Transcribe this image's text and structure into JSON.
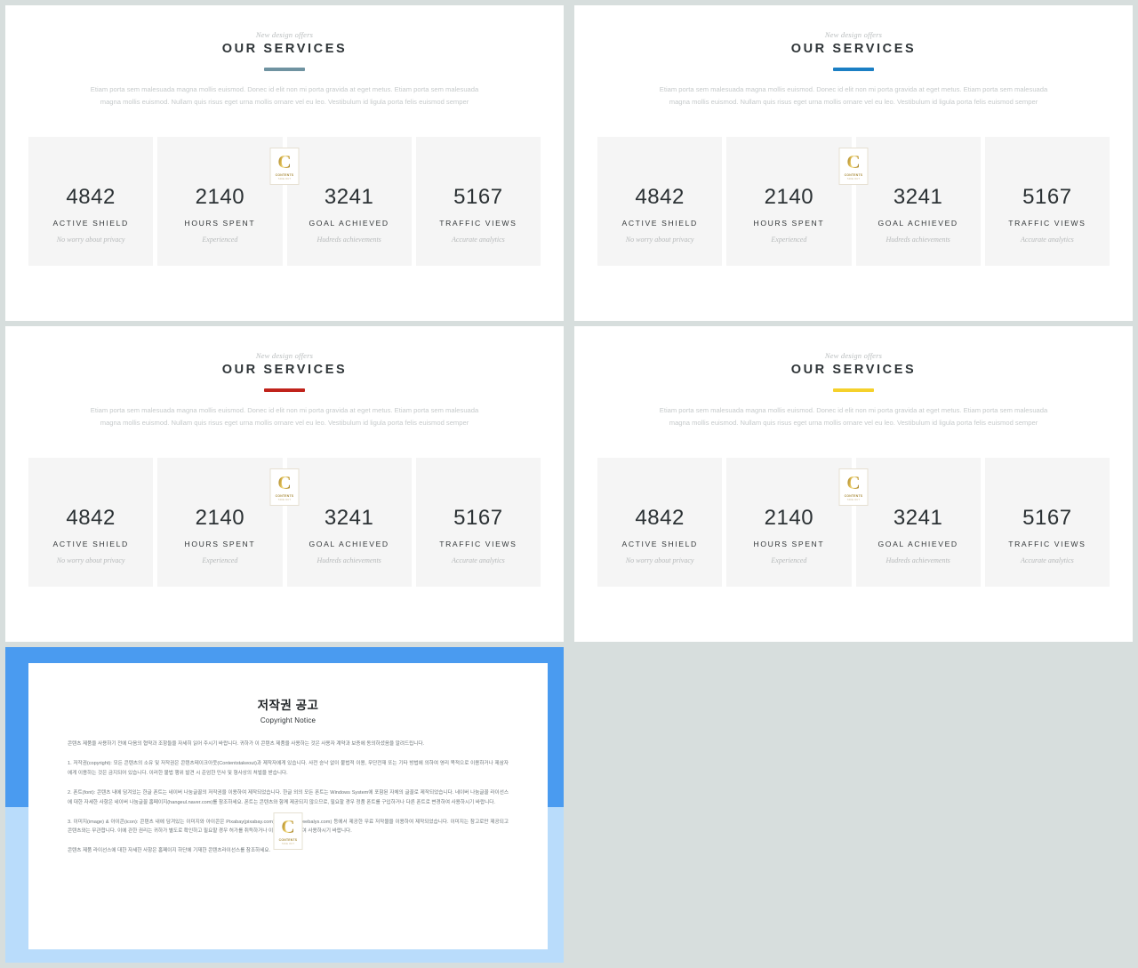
{
  "background_color": "#d7dedd",
  "slides": [
    {
      "id": "slide-1",
      "eyebrow": "New design offers",
      "title": "OUR SERVICES",
      "accent_color": "#6f93a1",
      "lead": "Etiam porta sem malesuada magna mollis euismod. Donec id elit non mi porta gravida at eget metus. Etiam porta sem malesuada magna mollis euismod. Nullam quis risus eget urna mollis ornare vel eu leo. Vestibulum id ligula porta felis euismod semper",
      "stats": [
        {
          "value": "4842",
          "label": "ACTIVE SHIELD",
          "sub": "No worry about privacy"
        },
        {
          "value": "2140",
          "label": "HOURS SPENT",
          "sub": "Experienced"
        },
        {
          "value": "3241",
          "label": "GOAL ACHIEVED",
          "sub": "Hudreds achievements"
        },
        {
          "value": "5167",
          "label": "TRAFFIC VIEWS",
          "sub": "Accurate analytics"
        }
      ]
    },
    {
      "id": "slide-2",
      "eyebrow": "New design offers",
      "title": "OUR SERVICES",
      "accent_color": "#1b7fc4",
      "lead": "Etiam porta sem malesuada magna mollis euismod. Donec id elit non mi porta gravida at eget metus. Etiam porta sem malesuada magna mollis euismod. Nullam quis risus eget urna mollis ornare vel eu leo. Vestibulum id ligula porta felis euismod semper",
      "stats": [
        {
          "value": "4842",
          "label": "ACTIVE SHIELD",
          "sub": "No worry about privacy"
        },
        {
          "value": "2140",
          "label": "HOURS SPENT",
          "sub": "Experienced"
        },
        {
          "value": "3241",
          "label": "GOAL ACHIEVED",
          "sub": "Hudreds achievements"
        },
        {
          "value": "5167",
          "label": "TRAFFIC VIEWS",
          "sub": "Accurate analytics"
        }
      ]
    },
    {
      "id": "slide-3",
      "eyebrow": "New design offers",
      "title": "OUR SERVICES",
      "accent_color": "#c0231b",
      "lead": "Etiam porta sem malesuada magna mollis euismod. Donec id elit non mi porta gravida at eget metus. Etiam porta sem malesuada magna mollis euismod. Nullam quis risus eget urna mollis ornare vel eu leo. Vestibulum id ligula porta felis euismod semper",
      "stats": [
        {
          "value": "4842",
          "label": "ACTIVE SHIELD",
          "sub": "No worry about privacy"
        },
        {
          "value": "2140",
          "label": "HOURS SPENT",
          "sub": "Experienced"
        },
        {
          "value": "3241",
          "label": "GOAL ACHIEVED",
          "sub": "Hudreds achievements"
        },
        {
          "value": "5167",
          "label": "TRAFFIC VIEWS",
          "sub": "Accurate analytics"
        }
      ]
    },
    {
      "id": "slide-4",
      "eyebrow": "New design offers",
      "title": "OUR SERVICES",
      "accent_color": "#f5d12b",
      "lead": "Etiam porta sem malesuada magna mollis euismod. Donec id elit non mi porta gravida at eget metus. Etiam porta sem malesuada magna mollis euismod. Nullam quis risus eget urna mollis ornare vel eu leo. Vestibulum id ligula porta felis euismod semper",
      "stats": [
        {
          "value": "4842",
          "label": "ACTIVE SHIELD",
          "sub": "No worry about privacy"
        },
        {
          "value": "2140",
          "label": "HOURS SPENT",
          "sub": "Experienced"
        },
        {
          "value": "3241",
          "label": "GOAL ACHIEVED",
          "sub": "Hudreds achievements"
        },
        {
          "value": "5167",
          "label": "TRAFFIC VIEWS",
          "sub": "Accurate analytics"
        }
      ]
    }
  ],
  "watermark": {
    "letter": "C",
    "line1": "CONTENTS",
    "line2": "TAKE OUT",
    "color": "#c29a30"
  },
  "copyright_slide": {
    "frame_color": "#4a9bf0",
    "frame_color_light": "#b9dcfb",
    "title_ko": "저작권 공고",
    "title_en": "Copyright Notice",
    "paragraphs": [
      "콘텐츠 제품을 사용하기 전에 다음의 협약과 조항들을 자세히 읽어 주시기 바랍니다. 귀하가 이 콘텐츠 제품을 사용하는 것은 사용자 계약과 보증에 동의하셨음을 알려드립니다.",
      "1. 저작권(copyright): 모든 콘텐츠의 소유 및 저작권은 콘텐츠테이크아웃(Contentstakeout)과 제작자에게 있습니다. 사전 승낙 없이 불법적 이용, 무단전재 또는 기타 방법에 의하여 영리 목적으로 이용하거나 제삼자에게 이용하는 것은 금지되어 있습니다. 이러한 불법 행위 발견 시 준엄한 민사 및 형사상의 처벌을 받습니다.",
      "2. 폰트(font): 콘텐츠 내에 담겨있는 한글 폰트는 네이버 나눔글꼴의 저작권을 이용하여 제작되었습니다. 한글 외의 모든 폰트는 Windows System에 포함된 자체의 글꼴로 제작되었습니다. 네이버 나눔글꼴 라이선스에 대한 자세한 사항은 네이버 나눔글꼴 홈페이지(hangeul.naver.com)를 참조하세요. 폰트는 콘텐츠와 함께 제공되지 않으므로, 필요할 경우 정품 폰트를 구입하거나 다른 폰트로 변경하여 사용하시기 바랍니다.",
      "3. 이미지(image) & 아이콘(icon): 콘텐츠 내에 담겨있는 이미지와 아이콘은 Pixabay(pixabay.com)와 Webalys(webalys.com) 등에서 제공한 무료 저작물을 이용하여 제작되었습니다. 이미지는 참고로만 제공되고 콘텐츠와는 무관합니다. 이에 관한 권리는 귀하가 별도로 확인하고 필요할 경우 허가를 취득하거나 이미지를 변경하여 사용하시기 바랍니다.",
      "콘텐츠 제품 라이선스에 대한 자세한 사항은 홈페이지 하단에 기재한 콘텐츠라이선스를 참조하세요."
    ]
  }
}
